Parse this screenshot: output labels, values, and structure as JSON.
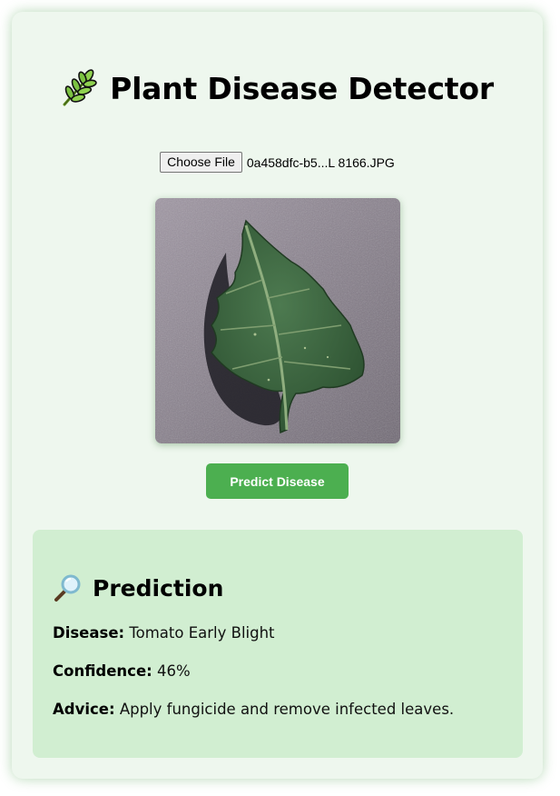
{
  "header": {
    "icon": "herb-leaf-icon",
    "title": "Plant Disease Detector"
  },
  "upload": {
    "button_label": "Choose File",
    "file_name": "0a458dfc-b5...L 8166.JPG"
  },
  "preview": {
    "image": "uploaded tomato leaf photo"
  },
  "actions": {
    "predict_label": "Predict Disease"
  },
  "result": {
    "icon": "magnifying-glass-icon",
    "heading": "Prediction",
    "disease_label": "Disease:",
    "disease_value": "Tomato Early Blight",
    "confidence_label": "Confidence:",
    "confidence_value": "46%",
    "advice_label": "Advice:",
    "advice_value": "Apply fungicide and remove infected leaves."
  },
  "colors": {
    "card_bg": "#eef7ee",
    "result_bg": "#d1eed1",
    "accent": "#4caf50"
  }
}
